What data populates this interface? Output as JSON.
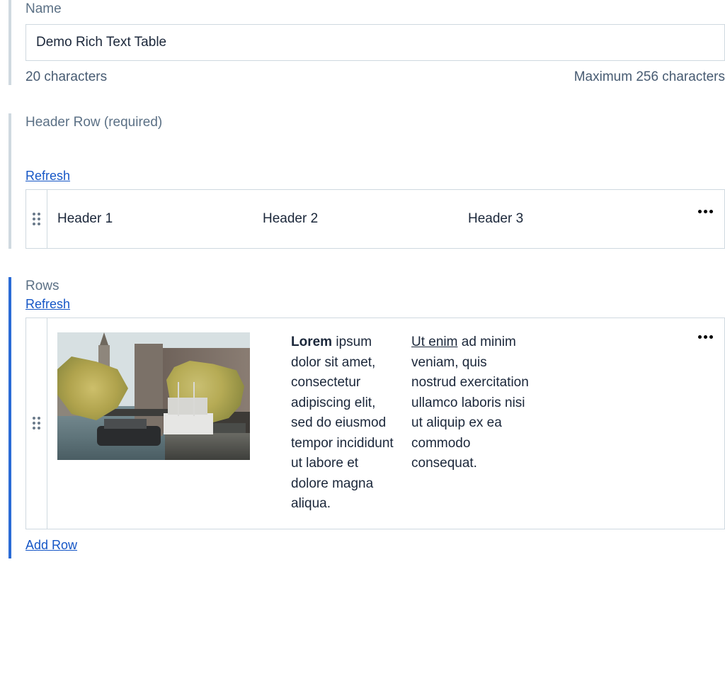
{
  "name_field": {
    "label": "Name",
    "value": "Demo Rich Text Table",
    "char_count": "20 characters",
    "max_hint": "Maximum 256 characters"
  },
  "header_field": {
    "label": "Header Row (required)",
    "refresh_label": "Refresh",
    "columns": [
      "Header 1",
      "Header 2",
      "Header 3"
    ]
  },
  "rows_field": {
    "label": "Rows",
    "refresh_label": "Refresh",
    "add_row_label": "Add Row",
    "row1": {
      "col2_bold": "Lorem",
      "col2_rest": " ipsum dolor sit amet, consectetur adipiscing elit, sed do eiusmod tempor incididunt ut labore et dolore magna aliqua.",
      "col3_under": "Ut enim",
      "col3_rest": " ad minim veniam, quis nostrud exercitation ullamco laboris nisi ut aliquip ex ea commodo consequat."
    }
  }
}
